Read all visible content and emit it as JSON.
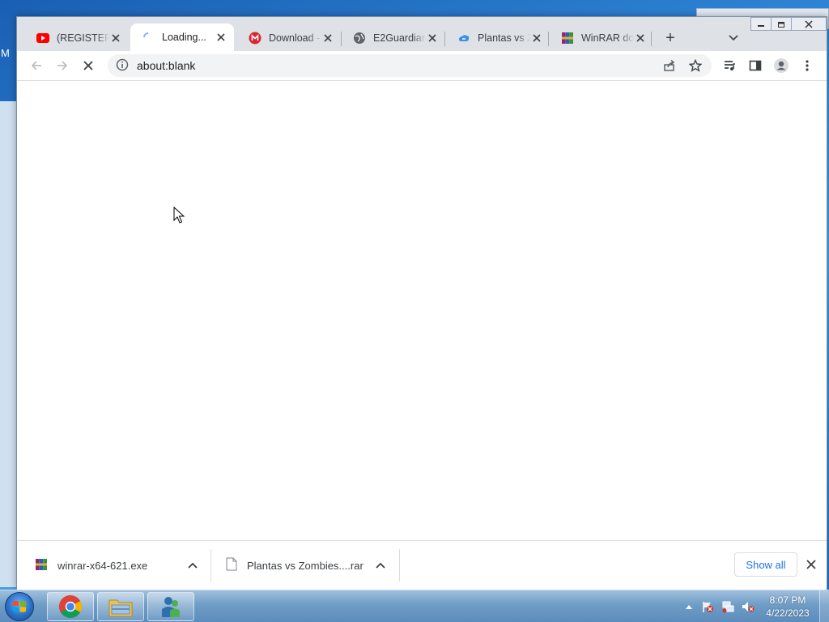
{
  "desktop": {
    "left_edge_letter": "M"
  },
  "browser": {
    "tabs": [
      {
        "title": "(REGISTERED",
        "icon": "youtube-icon"
      },
      {
        "title": "Loading...",
        "icon": "spinner-icon"
      },
      {
        "title": "Download -",
        "icon": "mega-icon"
      },
      {
        "title": "E2Guardian",
        "icon": "globe-icon"
      },
      {
        "title": "Plantas vs Z",
        "icon": "cloud-icon"
      },
      {
        "title": "WinRAR dow",
        "icon": "winrar-icon"
      }
    ],
    "active_tab_index": 1,
    "new_tab_label": "+",
    "omnibox": {
      "url": "about:blank"
    }
  },
  "downloads": {
    "items": [
      {
        "name": "winrar-x64-621.exe",
        "icon": "winrar-icon"
      },
      {
        "name": "Plantas vs Zombies....rar",
        "icon": "file-icon"
      }
    ],
    "show_all_label": "Show all"
  },
  "taskbar": {
    "clock_time": "8:07 PM",
    "clock_date": "4/22/2023"
  },
  "colors": {
    "accent": "#1a73e8",
    "tab_strip": "#dee1e6",
    "youtube_red": "#ff0000",
    "mega_red": "#d9272e"
  }
}
